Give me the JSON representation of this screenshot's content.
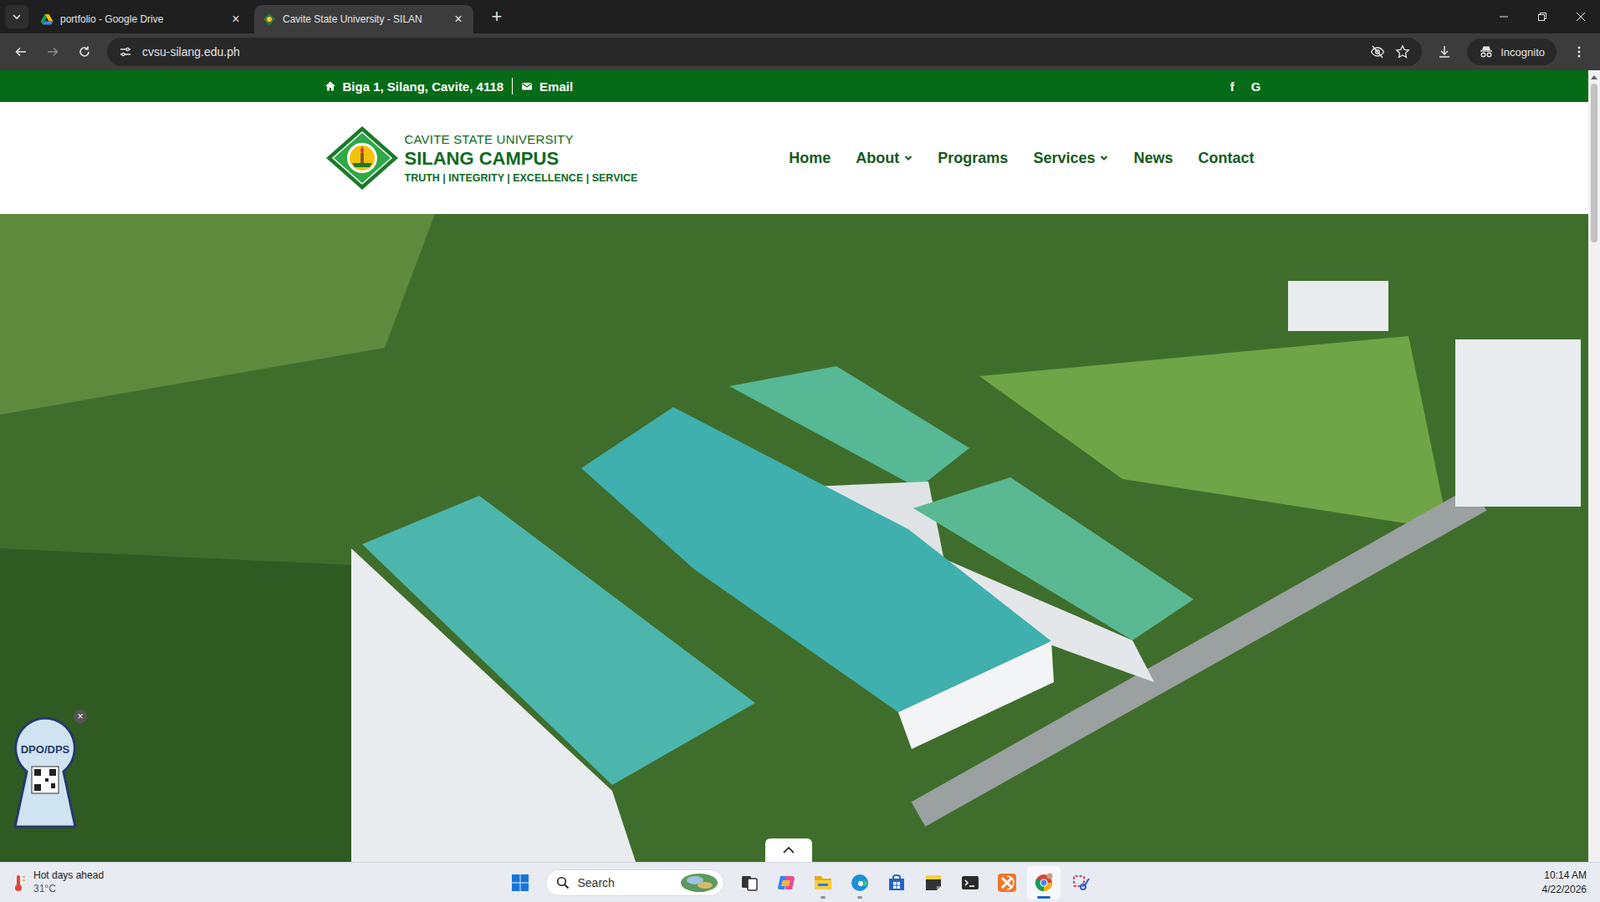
{
  "browser": {
    "tabs": [
      {
        "label": "portfolio - Google Drive",
        "selected": false
      },
      {
        "label": "Cavite State University - SILAN",
        "selected": true
      }
    ],
    "tab_close": "×",
    "new_tab": "+",
    "address": "cvsu-silang.edu.ph",
    "profile": "Incognito"
  },
  "topbar": {
    "address": "Biga 1, Silang, Cavite, 4118",
    "email": "Email",
    "social": [
      "f",
      "G"
    ]
  },
  "logo": {
    "university": "CAVITE STATE UNIVERSITY",
    "campus": "SILANG CAMPUS",
    "motto": "TRUTH | INTEGRITY | EXCELLENCE | SERVICE"
  },
  "nav": [
    {
      "label": "Home",
      "dropdown": false
    },
    {
      "label": "About",
      "dropdown": true
    },
    {
      "label": "Programs",
      "dropdown": false
    },
    {
      "label": "Services",
      "dropdown": true
    },
    {
      "label": "News",
      "dropdown": false
    },
    {
      "label": "Contact",
      "dropdown": false
    }
  ],
  "badge": {
    "title": "DPO/DPS",
    "close": "×"
  },
  "taskbar": {
    "weather": {
      "title": "Hot days ahead",
      "temp": "31°C"
    },
    "search": {
      "placeholder": "Search"
    },
    "apps": [
      {
        "kind": "task-view",
        "running": false,
        "selected": false
      },
      {
        "kind": "copilot",
        "running": false,
        "selected": false
      },
      {
        "kind": "explorer",
        "running": true,
        "selected": false
      },
      {
        "kind": "edge",
        "running": true,
        "selected": false
      },
      {
        "kind": "store",
        "running": false,
        "selected": false
      },
      {
        "kind": "sticky-notes",
        "running": false,
        "selected": false
      },
      {
        "kind": "terminal",
        "running": false,
        "selected": false
      },
      {
        "kind": "xampp",
        "running": false,
        "selected": false
      },
      {
        "kind": "chrome",
        "running": true,
        "selected": true
      },
      {
        "kind": "snipping",
        "running": false,
        "selected": false
      }
    ],
    "time": "10:14 AM",
    "date": "4/22/2026"
  }
}
